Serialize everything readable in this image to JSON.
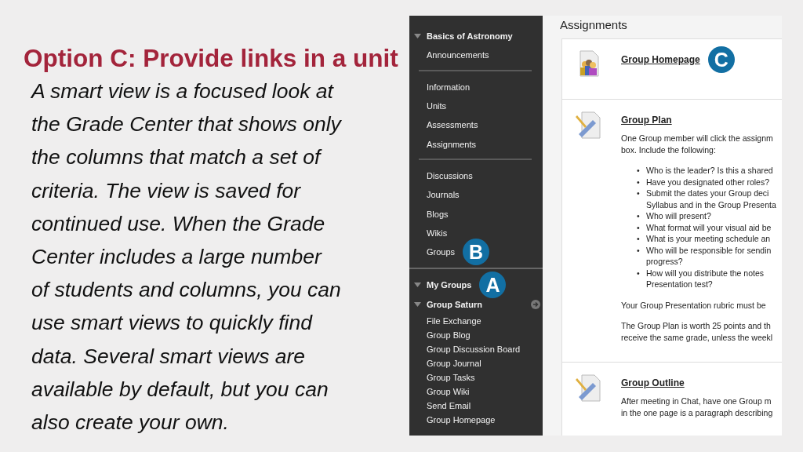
{
  "slide": {
    "title": "Option C: Provide links in a unit",
    "body": [
      "A smart view is a focused look at",
      "the Grade Center that shows only",
      "the columns that match a set of",
      "criteria. The view is saved for",
      "continued use. When the Grade",
      "Center includes a large number",
      "of students and columns, you can",
      "use smart views to quickly find",
      "data. Several smart views are",
      "available by default, but you can",
      "also create your own."
    ]
  },
  "sidebar": {
    "sections": [
      {
        "items": [
          {
            "label": "Basics of Astronomy",
            "kind": "header"
          },
          {
            "label": "Announcements",
            "kind": "link"
          }
        ]
      },
      {
        "items": [
          {
            "label": "Information",
            "kind": "link"
          },
          {
            "label": "Units",
            "kind": "link"
          },
          {
            "label": "Assessments",
            "kind": "link"
          },
          {
            "label": "Assignments",
            "kind": "link"
          }
        ]
      },
      {
        "items": [
          {
            "label": "Discussions",
            "kind": "link"
          },
          {
            "label": "Journals",
            "kind": "link"
          },
          {
            "label": "Blogs",
            "kind": "link"
          },
          {
            "label": "Wikis",
            "kind": "link"
          },
          {
            "label": "Groups",
            "kind": "link",
            "badge": "B"
          }
        ]
      },
      {
        "items": [
          {
            "label": "My Groups",
            "kind": "header",
            "badge": "A"
          },
          {
            "label": "Group Saturn",
            "kind": "group"
          },
          {
            "label": "File Exchange",
            "kind": "sub"
          },
          {
            "label": "Group Blog",
            "kind": "sub"
          },
          {
            "label": "Group Discussion Board",
            "kind": "sub"
          },
          {
            "label": "Group Journal",
            "kind": "sub"
          },
          {
            "label": "Group Tasks",
            "kind": "sub"
          },
          {
            "label": "Group Wiki",
            "kind": "sub"
          },
          {
            "label": "Send Email",
            "kind": "sub"
          },
          {
            "label": "Group Homepage",
            "kind": "sub"
          }
        ]
      }
    ]
  },
  "content": {
    "title": "Assignments",
    "items": [
      {
        "title": "Group Homepage",
        "kind": "homepage",
        "badge": "C"
      },
      {
        "title": "Group Plan",
        "kind": "assignment",
        "blocks": [
          {
            "kind": "text",
            "lines": [
              "One Group member will click the assignm",
              "box. Include the following:"
            ]
          },
          {
            "kind": "list",
            "marker": "•",
            "bullets": [
              [
                "Who is the leader? Is this a shared"
              ],
              [
                "Have you designated other roles?"
              ],
              [
                "Submit the dates your Group deci",
                "Syllabus and in the Group Presenta"
              ],
              [
                "Who will present?"
              ],
              [
                "What format will your visual aid be"
              ],
              [
                "What is your meeting schedule an"
              ],
              [
                "Who will be responsible for sendin",
                "progress?"
              ],
              [
                "How will you distribute the notes",
                "Presentation test?"
              ]
            ]
          },
          {
            "kind": "text",
            "lines": [
              "Your Group Presentation rubric must be"
            ]
          },
          {
            "kind": "text",
            "lines": [
              "The Group Plan is worth 25 points and th",
              "receive the same grade, unless the weekl"
            ]
          }
        ]
      },
      {
        "title": "Group Outline",
        "kind": "assignment",
        "blocks": [
          {
            "kind": "text",
            "lines": [
              "After meeting in Chat, have one Group m",
              "in the one page is a paragraph describing"
            ]
          }
        ]
      }
    ]
  }
}
